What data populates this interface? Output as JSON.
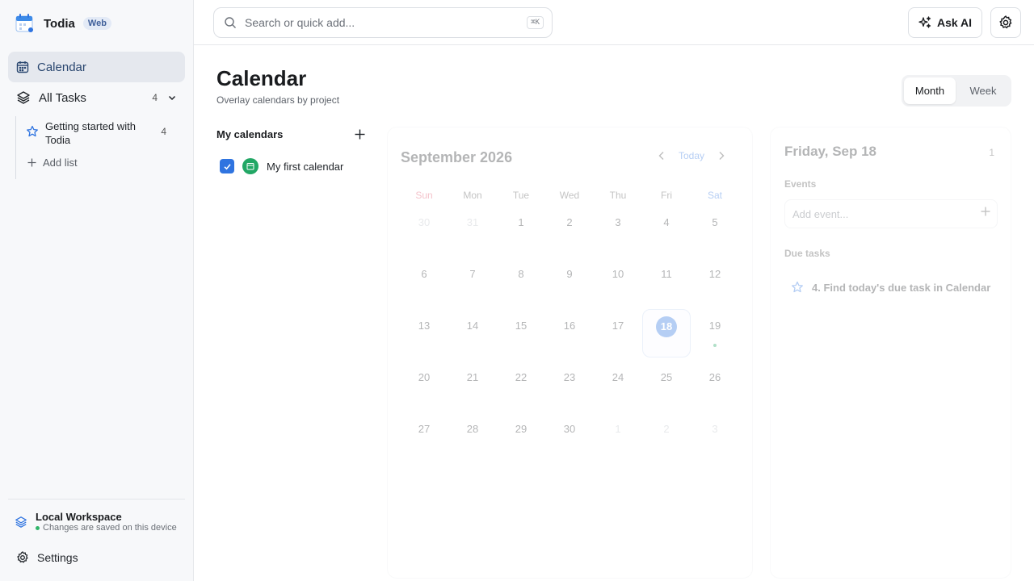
{
  "app": {
    "name": "Todia",
    "badge": "Web"
  },
  "sidebar": {
    "nav": [
      {
        "label": "Calendar",
        "icon": "calendar-icon",
        "active": true
      },
      {
        "label": "All Tasks",
        "icon": "layers-icon",
        "count": "4"
      }
    ],
    "project": {
      "label": "Getting started with Todia",
      "count": "4",
      "icon": "star-icon"
    },
    "add_list_label": "Add list",
    "workspace": {
      "title": "Local Workspace",
      "subtitle": "Changes are saved on this device"
    },
    "settings_label": "Settings"
  },
  "topbar": {
    "search_placeholder": "Search or quick add...",
    "search_shortcut": "⌘K",
    "ask_ai_label": "Ask AI"
  },
  "page": {
    "title": "Calendar",
    "subtitle": "Overlay calendars by project",
    "views": [
      "Month",
      "Week"
    ],
    "active_view": "Month"
  },
  "my_calendars": {
    "title": "My calendars",
    "items": [
      {
        "name": "My first calendar",
        "checked": true,
        "color": "#22a765"
      }
    ]
  },
  "month": {
    "title": "September 2026",
    "today_label": "Today",
    "weekdays": [
      "Sun",
      "Mon",
      "Tue",
      "Wed",
      "Thu",
      "Fri",
      "Sat"
    ],
    "weeks": [
      [
        "30",
        "31",
        "1",
        "2",
        "3",
        "4",
        "5"
      ],
      [
        "6",
        "7",
        "8",
        "9",
        "10",
        "11",
        "12"
      ],
      [
        "13",
        "14",
        "15",
        "16",
        "17",
        "18",
        "19"
      ],
      [
        "20",
        "21",
        "22",
        "23",
        "24",
        "25",
        "26"
      ],
      [
        "27",
        "28",
        "29",
        "30",
        "1",
        "2",
        "3"
      ]
    ],
    "selected_day": "18",
    "days_with_events": [
      "19"
    ]
  },
  "day_panel": {
    "title": "Friday, Sep 18",
    "count": "1",
    "events_label": "Events",
    "add_event_placeholder": "Add event...",
    "due_tasks_label": "Due tasks",
    "due_tasks": [
      "4. Find today's due task in Calendar"
    ]
  },
  "colors": {
    "accent": "#2f74e0",
    "calendar_green": "#22a765",
    "sidebar_bg": "#f7f8fa",
    "active_nav_bg": "#e5e8ee"
  }
}
